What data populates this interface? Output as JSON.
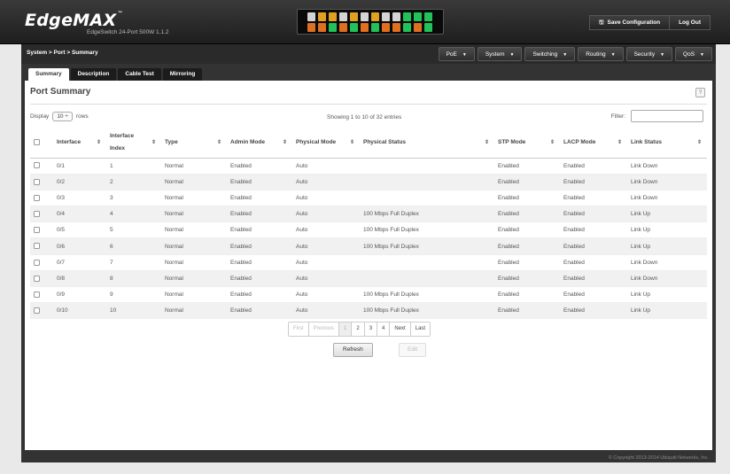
{
  "header": {
    "logo": "EdgeMAX",
    "logo_tm": "™",
    "model": "EdgeSwitch 24-Port 500W 1.1.2",
    "save_label": "Save Configuration",
    "logout_label": "Log Out",
    "port_colors_top": [
      "#d4d4d4",
      "#e0a020",
      "#e0a020",
      "#d4d4d4",
      "#e0a020",
      "#d4d4d4",
      "#e0a020",
      "#d4d4d4",
      "#d4d4d4",
      "#22c25a",
      "#22c25a",
      "#22c25a"
    ],
    "port_colors_bottom": [
      "#e07020",
      "#e07020",
      "#22c25a",
      "#e07020",
      "#22c25a",
      "#e07020",
      "#22c25a",
      "#e07020",
      "#e07020",
      "#22c25a",
      "#e07020",
      "#22c25a"
    ]
  },
  "breadcrumb": "System > Port > Summary",
  "nav": [
    {
      "label": "PoE"
    },
    {
      "label": "System"
    },
    {
      "label": "Switching"
    },
    {
      "label": "Routing"
    },
    {
      "label": "Security"
    },
    {
      "label": "QoS"
    }
  ],
  "tabs": [
    {
      "label": "Summary",
      "active": true
    },
    {
      "label": "Description",
      "active": false
    },
    {
      "label": "Cable Test",
      "active": false
    },
    {
      "label": "Mirroring",
      "active": false
    }
  ],
  "page_title": "Port Summary",
  "help_label": "?",
  "display": {
    "prefix": "Display",
    "value": "10 ÷",
    "suffix": "rows"
  },
  "showing": "Showing 1 to 10 of 32 entries",
  "filter_label": "Filter:",
  "columns": [
    {
      "label": "",
      "sortable": false
    },
    {
      "label": "Interface",
      "sortable": true
    },
    {
      "label": "Interface Index",
      "sortable": true
    },
    {
      "label": "Type",
      "sortable": true
    },
    {
      "label": "Admin Mode",
      "sortable": true
    },
    {
      "label": "Physical Mode",
      "sortable": true
    },
    {
      "label": "Physical Status",
      "sortable": true
    },
    {
      "label": "STP Mode",
      "sortable": true
    },
    {
      "label": "LACP Mode",
      "sortable": true
    },
    {
      "label": "Link Status",
      "sortable": true
    }
  ],
  "rows": [
    [
      "0/1",
      "1",
      "Normal",
      "Enabled",
      "Auto",
      "",
      "Enabled",
      "Enabled",
      "Link Down"
    ],
    [
      "0/2",
      "2",
      "Normal",
      "Enabled",
      "Auto",
      "",
      "Enabled",
      "Enabled",
      "Link Down"
    ],
    [
      "0/3",
      "3",
      "Normal",
      "Enabled",
      "Auto",
      "",
      "Enabled",
      "Enabled",
      "Link Down"
    ],
    [
      "0/4",
      "4",
      "Normal",
      "Enabled",
      "Auto",
      "100 Mbps Full Duplex",
      "Enabled",
      "Enabled",
      "Link Up"
    ],
    [
      "0/5",
      "5",
      "Normal",
      "Enabled",
      "Auto",
      "100 Mbps Full Duplex",
      "Enabled",
      "Enabled",
      "Link Up"
    ],
    [
      "0/6",
      "6",
      "Normal",
      "Enabled",
      "Auto",
      "100 Mbps Full Duplex",
      "Enabled",
      "Enabled",
      "Link Up"
    ],
    [
      "0/7",
      "7",
      "Normal",
      "Enabled",
      "Auto",
      "",
      "Enabled",
      "Enabled",
      "Link Down"
    ],
    [
      "0/8",
      "8",
      "Normal",
      "Enabled",
      "Auto",
      "",
      "Enabled",
      "Enabled",
      "Link Down"
    ],
    [
      "0/9",
      "9",
      "Normal",
      "Enabled",
      "Auto",
      "100 Mbps Full Duplex",
      "Enabled",
      "Enabled",
      "Link Up"
    ],
    [
      "0/10",
      "10",
      "Normal",
      "Enabled",
      "Auto",
      "100 Mbps Full Duplex",
      "Enabled",
      "Enabled",
      "Link Up"
    ]
  ],
  "pagination": [
    {
      "label": "First",
      "state": "disabled"
    },
    {
      "label": "Previous",
      "state": "disabled"
    },
    {
      "label": "1",
      "state": "current"
    },
    {
      "label": "2",
      "state": "normal"
    },
    {
      "label": "3",
      "state": "normal"
    },
    {
      "label": "4",
      "state": "normal"
    },
    {
      "label": "Next",
      "state": "normal"
    },
    {
      "label": "Last",
      "state": "normal"
    }
  ],
  "refresh_label": "Refresh",
  "edit_label": "Edit",
  "copyright": "© Copyright 2013-2014 Ubiquiti Networks, Inc."
}
